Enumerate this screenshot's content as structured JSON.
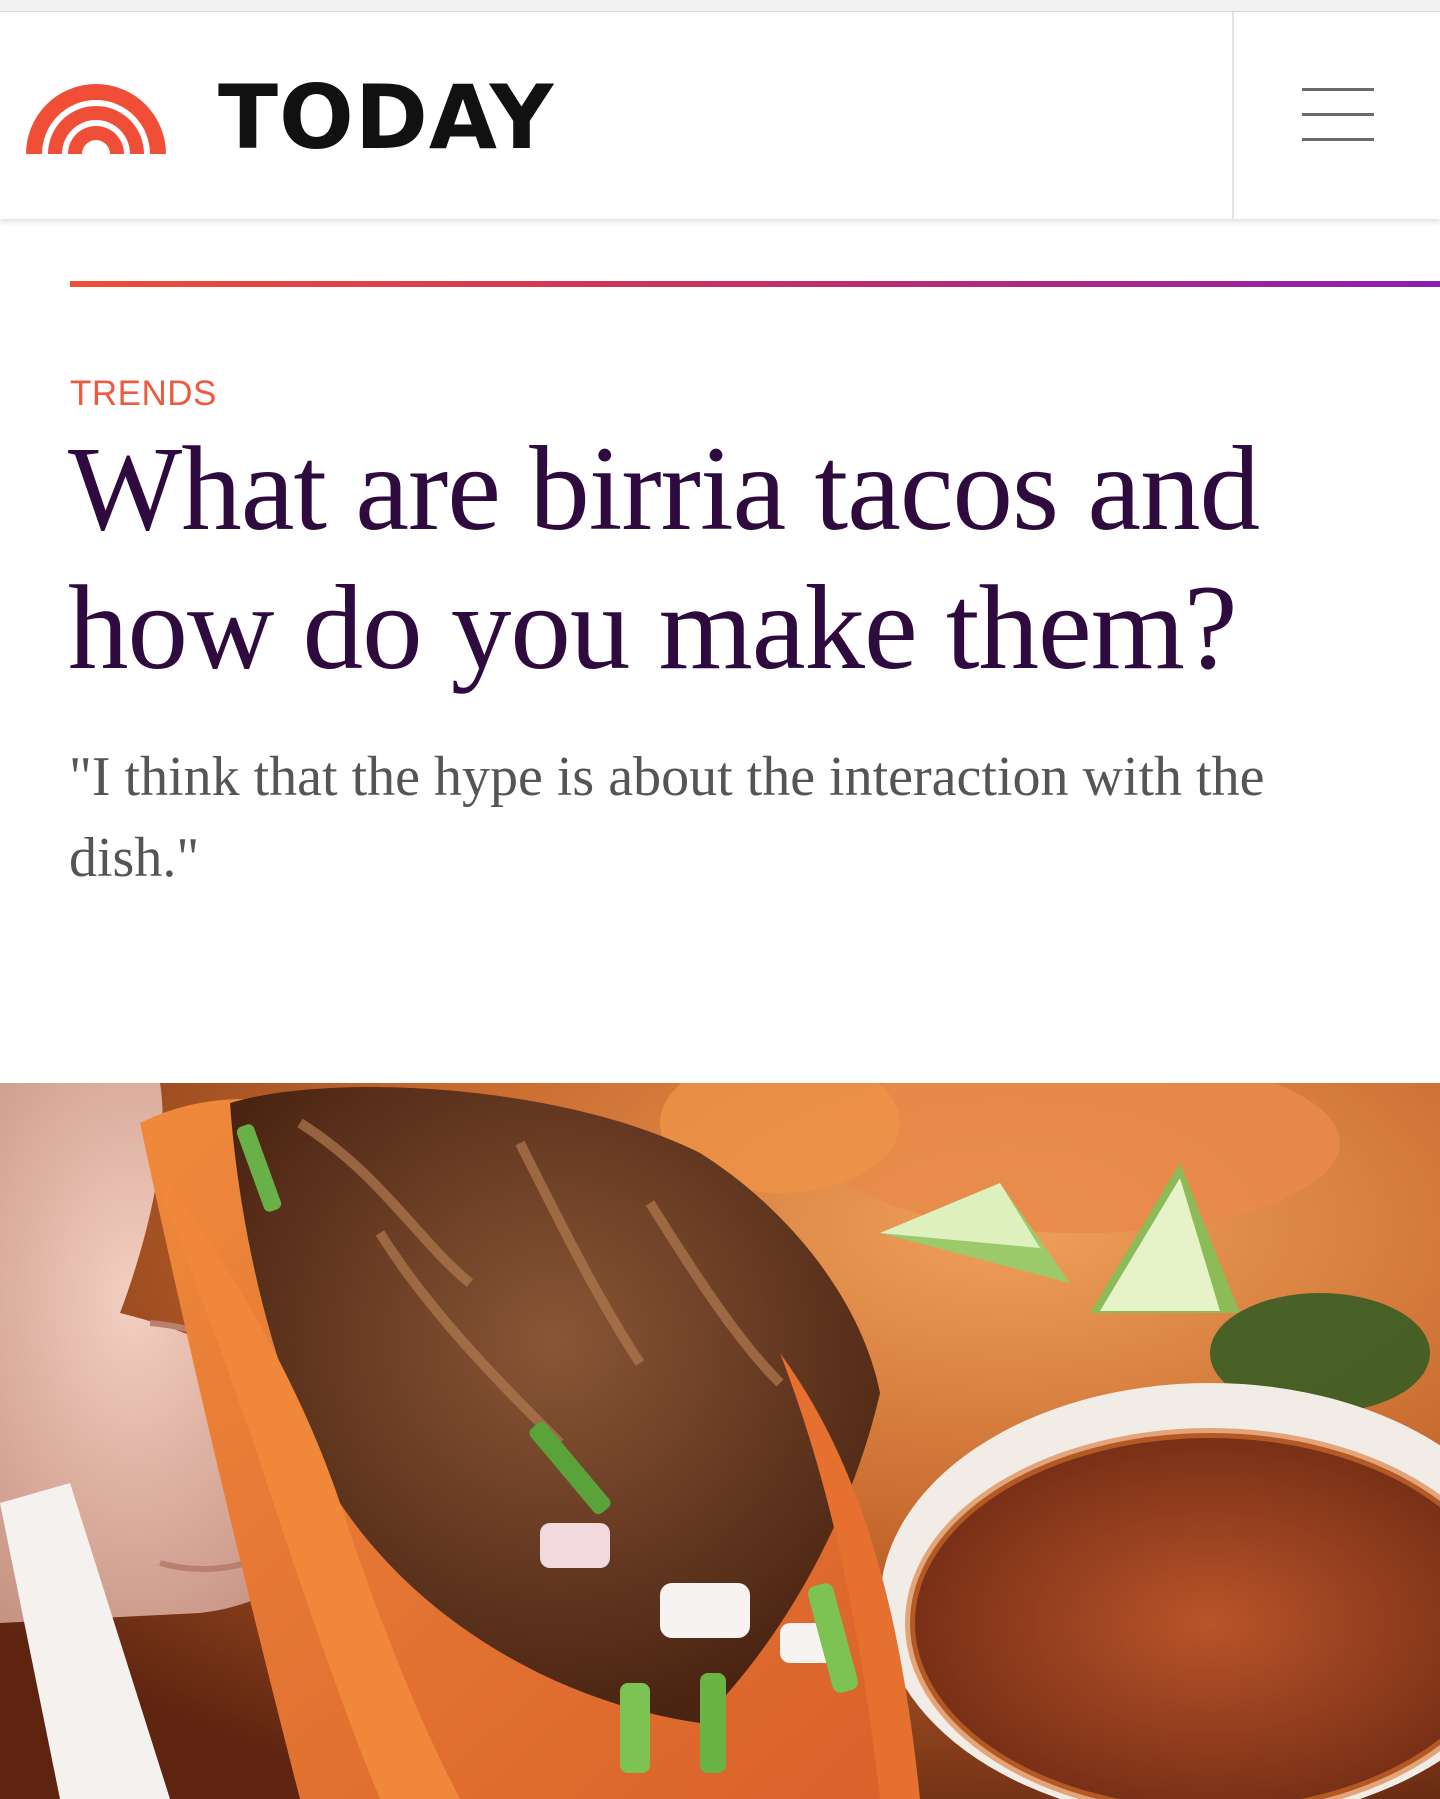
{
  "header": {
    "brand_name": "TODAY",
    "logo_icon": "rainbow-arch-icon",
    "menu_icon": "hamburger-menu-icon",
    "brand_color": "#f04e37",
    "text_color": "#111111"
  },
  "article": {
    "section": "TRENDS",
    "headline": "What are birria tacos and how do you make them?",
    "dek": "\"I think that the hype is about the interaction with the dish.\"",
    "accent_gradient": [
      "#f04e37",
      "#8a1fb0"
    ],
    "headline_color": "#2e0a3e",
    "kicker_color": "#ef5a3f"
  },
  "hero_image": {
    "subject": "birria-taco-photo"
  }
}
